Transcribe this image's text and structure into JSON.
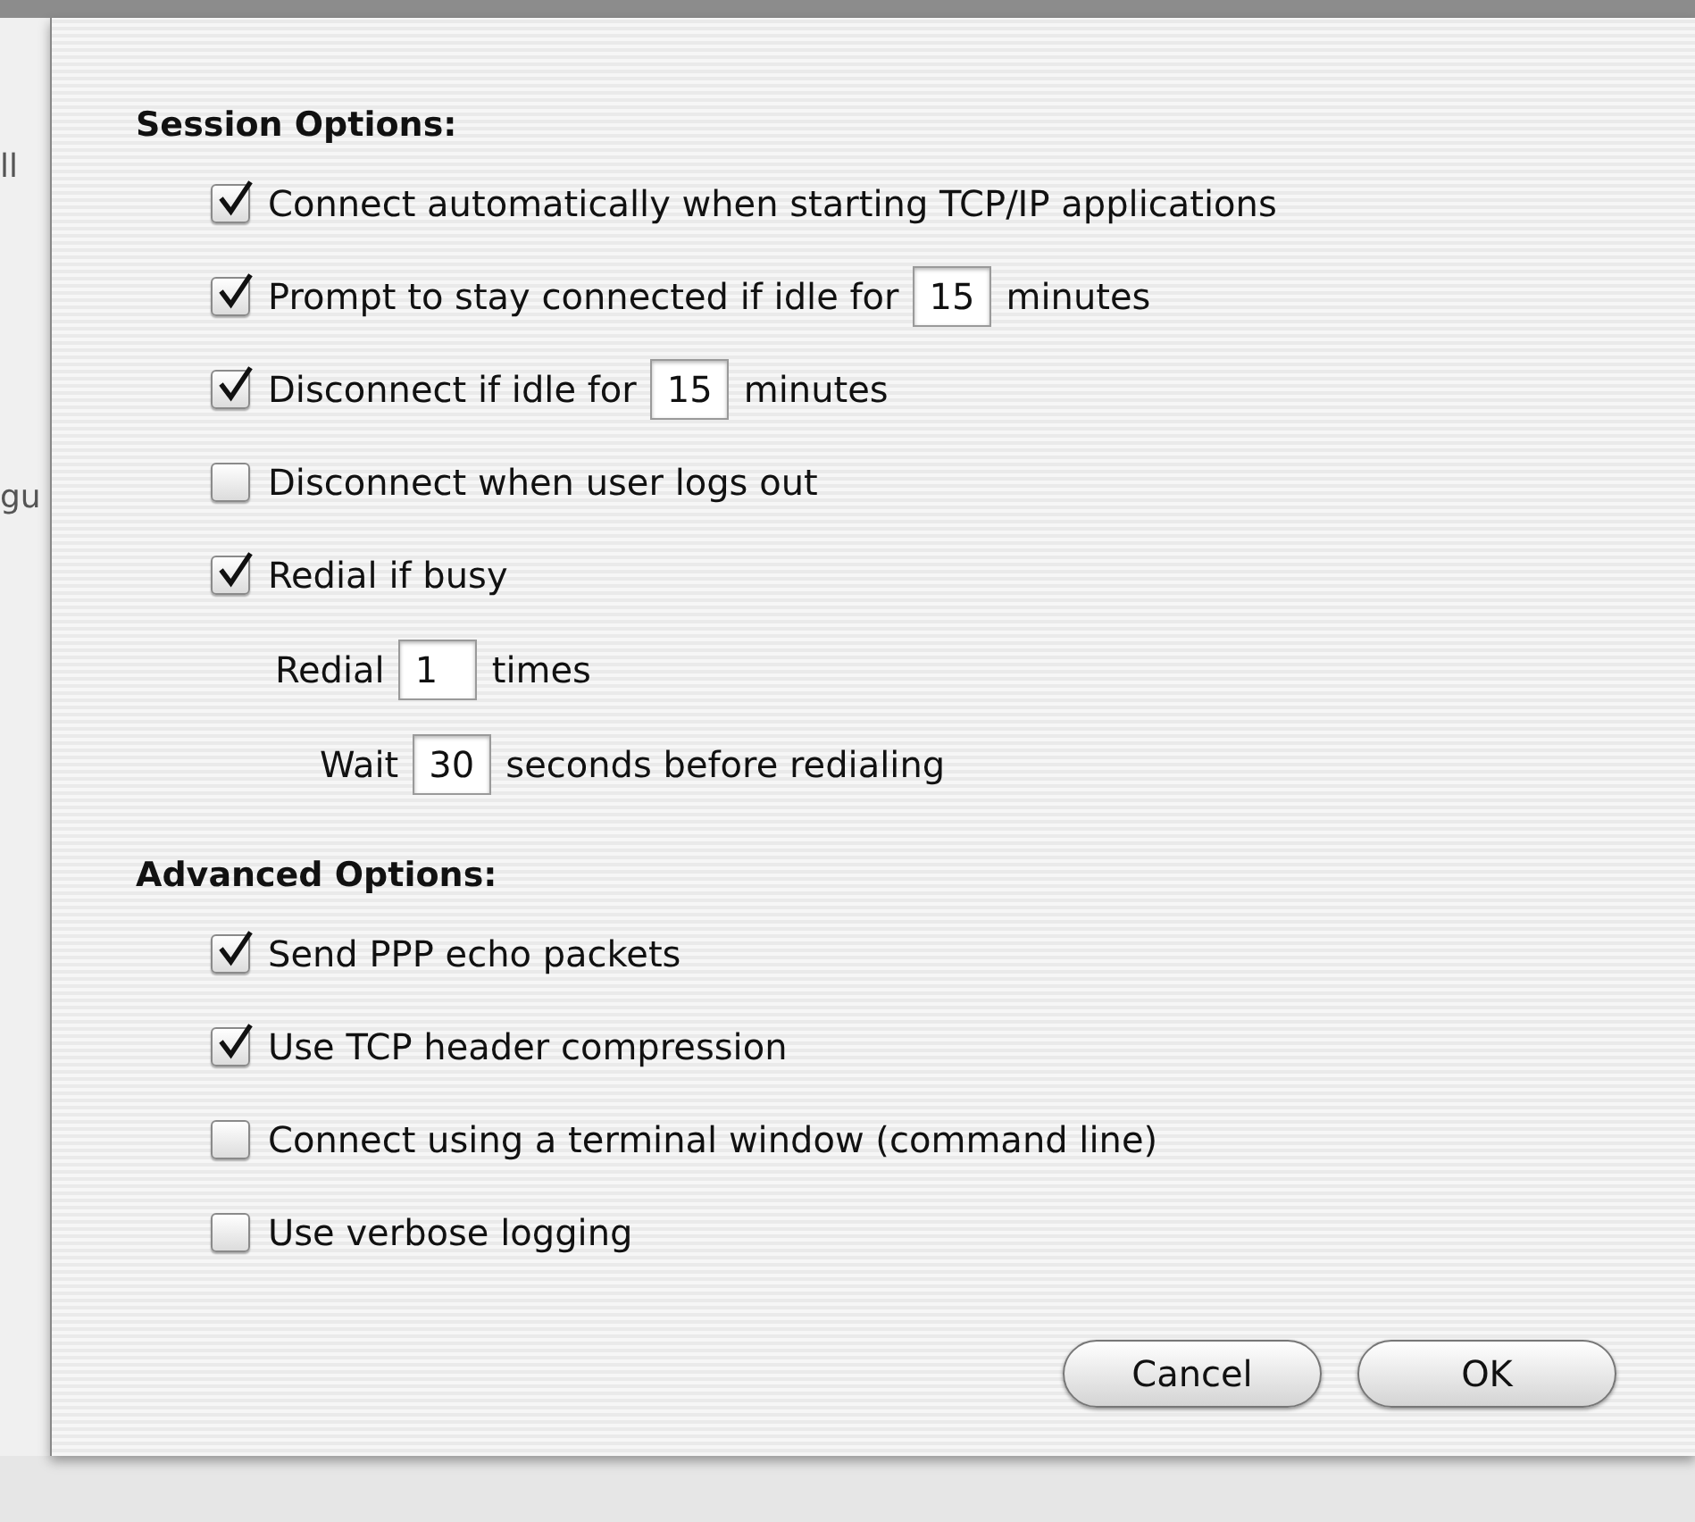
{
  "background_window": {
    "fragments": [
      "ll",
      "gu"
    ]
  },
  "sections": [
    {
      "title": "Session Options:",
      "items": [
        {
          "kind": "checkbox",
          "checked": true,
          "parts": [
            {
              "text": "Connect automatically when starting TCP/IP applications"
            }
          ]
        },
        {
          "kind": "checkbox",
          "checked": true,
          "parts": [
            {
              "text": "Prompt to stay connected if idle for"
            },
            {
              "field": "15"
            },
            {
              "text": "minutes"
            }
          ]
        },
        {
          "kind": "checkbox",
          "checked": true,
          "parts": [
            {
              "text": "Disconnect if idle for"
            },
            {
              "field": "15"
            },
            {
              "text": "minutes"
            }
          ]
        },
        {
          "kind": "checkbox",
          "checked": false,
          "parts": [
            {
              "text": "Disconnect when user logs out"
            }
          ]
        },
        {
          "kind": "checkbox",
          "checked": true,
          "parts": [
            {
              "text": "Redial if busy"
            }
          ],
          "children": [
            {
              "kind": "plain",
              "parts": [
                {
                  "text": "Redial"
                },
                {
                  "field": "1"
                },
                {
                  "text": "times"
                }
              ],
              "children": [
                {
                  "kind": "plain",
                  "parts": [
                    {
                      "text": "Wait"
                    },
                    {
                      "field": "30"
                    },
                    {
                      "text": "seconds before redialing"
                    }
                  ]
                }
              ]
            }
          ]
        }
      ]
    },
    {
      "title": "Advanced Options:",
      "items": [
        {
          "kind": "checkbox",
          "checked": true,
          "parts": [
            {
              "text": "Send PPP echo packets"
            }
          ]
        },
        {
          "kind": "checkbox",
          "checked": true,
          "parts": [
            {
              "text": "Use TCP header compression"
            }
          ]
        },
        {
          "kind": "checkbox",
          "checked": false,
          "parts": [
            {
              "text": "Connect using a terminal window (command line)"
            }
          ]
        },
        {
          "kind": "checkbox",
          "checked": false,
          "parts": [
            {
              "text": "Use verbose logging"
            }
          ]
        }
      ]
    }
  ],
  "buttons": [
    {
      "label": "Cancel",
      "default": false
    },
    {
      "label": "OK",
      "default": false
    }
  ]
}
